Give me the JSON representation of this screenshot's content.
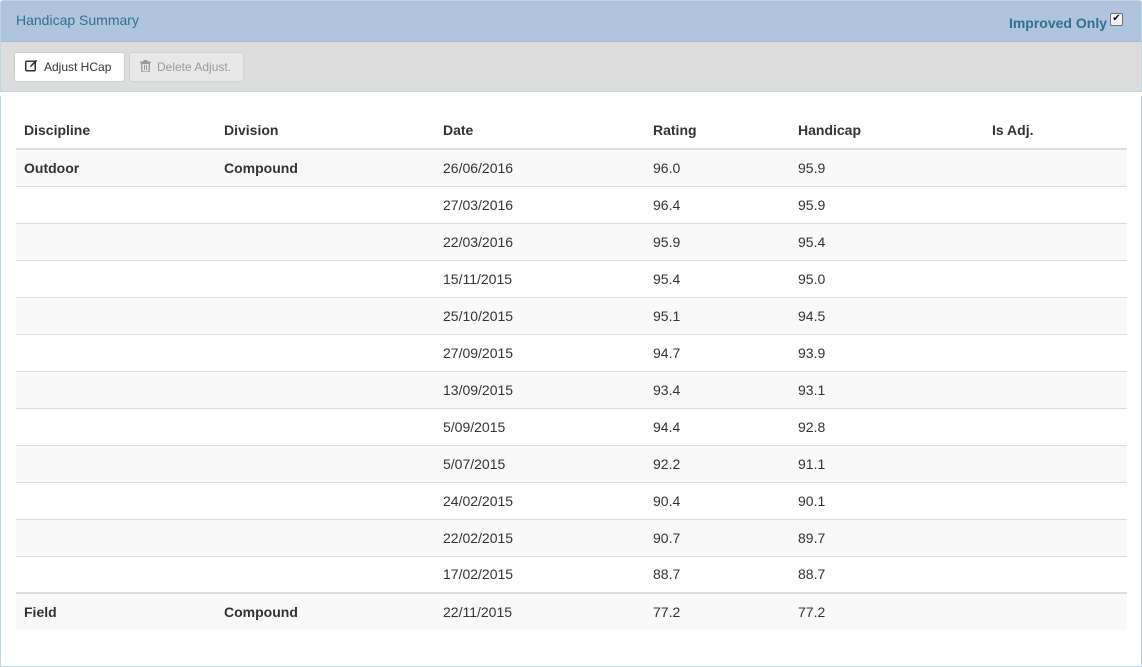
{
  "header": {
    "title": "Handicap Summary",
    "improved_only_label": "Improved Only",
    "improved_only_checked": true
  },
  "toolbar": {
    "adjust_label": "Adjust HCap",
    "delete_label": "Delete Adjust.",
    "adjust_icon": "edit-icon",
    "delete_icon": "trash-icon"
  },
  "table": {
    "columns": [
      "Discipline",
      "Division",
      "Date",
      "Rating",
      "Handicap",
      "Is Adj."
    ],
    "rows": [
      {
        "discipline": "Outdoor",
        "division": "Compound",
        "date": "26/06/2016",
        "rating": "96.0",
        "handicap": "95.9",
        "is_adj": ""
      },
      {
        "discipline": "",
        "division": "",
        "date": "27/03/2016",
        "rating": "96.4",
        "handicap": "95.9",
        "is_adj": ""
      },
      {
        "discipline": "",
        "division": "",
        "date": "22/03/2016",
        "rating": "95.9",
        "handicap": "95.4",
        "is_adj": ""
      },
      {
        "discipline": "",
        "division": "",
        "date": "15/11/2015",
        "rating": "95.4",
        "handicap": "95.0",
        "is_adj": ""
      },
      {
        "discipline": "",
        "division": "",
        "date": "25/10/2015",
        "rating": "95.1",
        "handicap": "94.5",
        "is_adj": ""
      },
      {
        "discipline": "",
        "division": "",
        "date": "27/09/2015",
        "rating": "94.7",
        "handicap": "93.9",
        "is_adj": ""
      },
      {
        "discipline": "",
        "division": "",
        "date": "13/09/2015",
        "rating": "93.4",
        "handicap": "93.1",
        "is_adj": ""
      },
      {
        "discipline": "",
        "division": "",
        "date": "5/09/2015",
        "rating": "94.4",
        "handicap": "92.8",
        "is_adj": ""
      },
      {
        "discipline": "",
        "division": "",
        "date": "5/07/2015",
        "rating": "92.2",
        "handicap": "91.1",
        "is_adj": ""
      },
      {
        "discipline": "",
        "division": "",
        "date": "24/02/2015",
        "rating": "90.4",
        "handicap": "90.1",
        "is_adj": ""
      },
      {
        "discipline": "",
        "division": "",
        "date": "22/02/2015",
        "rating": "90.7",
        "handicap": "89.7",
        "is_adj": ""
      },
      {
        "discipline": "",
        "division": "",
        "date": "17/02/2015",
        "rating": "88.7",
        "handicap": "88.7",
        "is_adj": ""
      },
      {
        "discipline": "Field",
        "division": "Compound",
        "date": "22/11/2015",
        "rating": "77.2",
        "handicap": "77.2",
        "is_adj": ""
      }
    ]
  },
  "colors": {
    "header_bg": "#b0c4de",
    "header_text": "#31708f",
    "toolbar_bg": "#dcdcdc",
    "row_stripe": "#f9f9f9",
    "border": "#dddddd"
  }
}
